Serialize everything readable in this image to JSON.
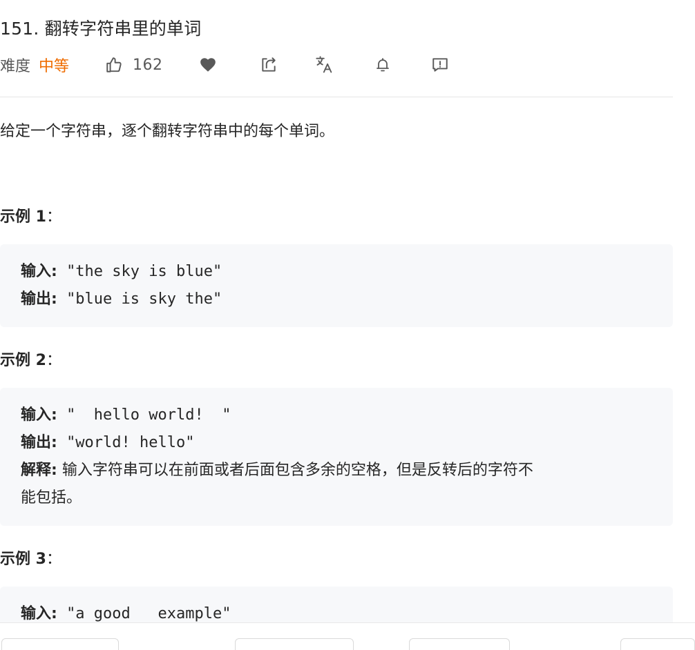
{
  "problem": {
    "title": "151. 翻转字符串里的单词",
    "difficulty_label": "难度",
    "difficulty": "中等",
    "like_count": "162",
    "description": "给定一个字符串，逐个翻转字符串中的每个单词。"
  },
  "icons": {
    "like": "thumbs-up-icon",
    "favorite": "heart-icon",
    "share": "share-icon",
    "translate": "translate-icon",
    "notify": "bell-icon",
    "feedback": "feedback-icon"
  },
  "colors": {
    "difficulty_medium": "#ef6c00",
    "code_background": "#f7f8fa",
    "divider": "#e5e5e5"
  },
  "examples": [
    {
      "title": "示例 1",
      "colon": "：",
      "input_label": "输入:",
      "input_value": "\"the sky is blue\"",
      "output_label": "输出:",
      "output_value": "\"blue is sky the\""
    },
    {
      "title": "示例 2",
      "colon": "：",
      "input_label": "输入:",
      "input_value": "\"  hello world!  \"",
      "output_label": "输出:",
      "output_value": "\"world! hello\"",
      "explain_label": "解释:",
      "explain_line1": "输入字符串可以在前面或者后面包含多余的空格，但是反转后的字符不",
      "explain_line2": "能包括。"
    },
    {
      "title": "示例 3",
      "colon": "：",
      "input_label": "输入:",
      "input_value": "\"a good   example\""
    }
  ]
}
